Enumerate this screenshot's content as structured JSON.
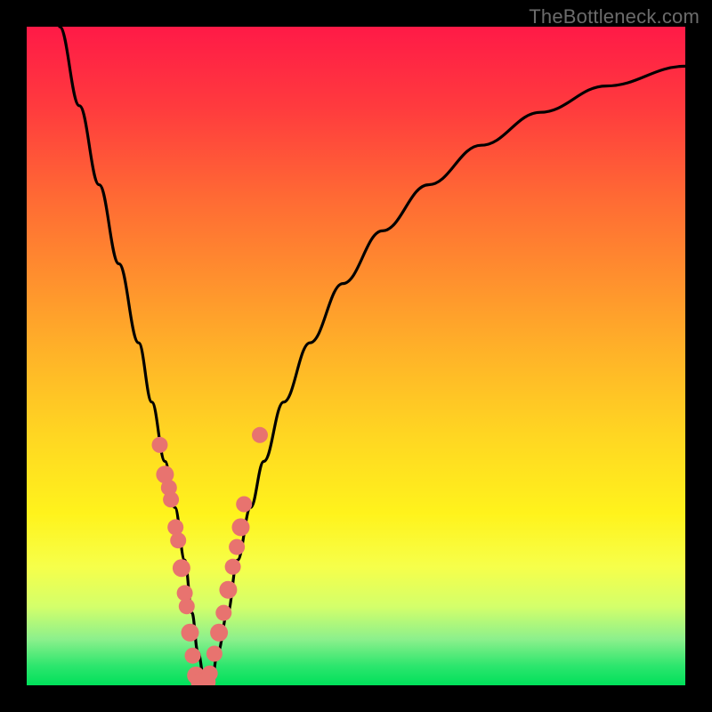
{
  "watermark": "TheBottleneck.com",
  "chart_data": {
    "type": "line",
    "title": "",
    "xlabel": "",
    "ylabel": "",
    "xlim": [
      0,
      100
    ],
    "ylim": [
      0,
      100
    ],
    "series": [
      {
        "name": "bottleneck-curve",
        "x": [
          5,
          8,
          11,
          14,
          17,
          19,
          21,
          22.5,
          24,
          25.1,
          26,
          27.1,
          28,
          29,
          30.5,
          32,
          34,
          36,
          39,
          43,
          48,
          54,
          61,
          69,
          78,
          88,
          100
        ],
        "y": [
          100,
          88,
          76,
          64,
          52,
          43,
          34,
          27,
          19,
          11,
          5,
          0,
          0,
          5,
          11,
          19,
          27,
          34,
          43,
          52,
          61,
          69,
          76,
          82,
          87,
          91,
          94
        ]
      }
    ],
    "points": {
      "name": "sample-markers",
      "x": [
        20.2,
        21.0,
        21.6,
        21.9,
        22.6,
        23.0,
        23.5,
        24.0,
        24.3,
        24.8,
        25.2,
        25.7,
        26.4,
        27.2,
        27.8,
        28.5,
        29.2,
        29.9,
        30.6,
        31.3,
        31.9,
        32.5,
        33.0,
        35.4
      ],
      "y": [
        36.5,
        32.0,
        30.0,
        28.2,
        24.0,
        22.0,
        17.8,
        14.0,
        12.0,
        8.0,
        4.5,
        1.5,
        0.5,
        0.5,
        1.8,
        4.8,
        8.0,
        11.0,
        14.5,
        18.0,
        21.0,
        24.0,
        27.5,
        38.0
      ],
      "r": [
        9,
        10,
        9,
        9,
        9,
        9,
        10,
        9,
        9,
        10,
        9,
        10,
        11,
        11,
        9,
        9,
        10,
        9,
        10,
        9,
        9,
        10,
        9,
        9
      ]
    },
    "gradient_note": "vertical red→orange→yellow→green maps roughly to y=100→0",
    "colors": {
      "curve": "#000000",
      "dot_fill": "#e8736f",
      "gradient_top": "#ff1a47",
      "gradient_bottom": "#00e05a"
    }
  }
}
